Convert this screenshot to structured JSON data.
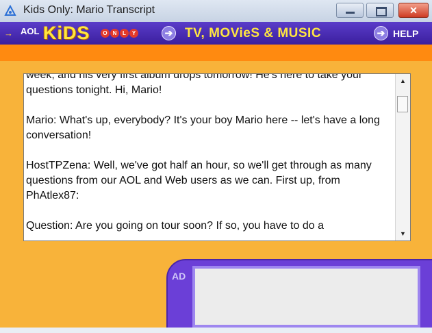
{
  "window": {
    "title": "Kids Only:  Mario Transcript",
    "controls": [
      "minimize",
      "maximize",
      "close"
    ]
  },
  "navbar": {
    "brand_aol": "AOL",
    "brand_kids": "KiDS",
    "brand_only": [
      "O",
      "N",
      "L",
      "Y"
    ],
    "channel_label": "TV, MOVieS & MUSIC",
    "help_label": "HELP",
    "colors": {
      "bar": "#4a2db3",
      "text_accent": "#ffe640",
      "orange_band": "#ff8a10",
      "background": "#f8b33a"
    }
  },
  "transcript": {
    "paragraphs": [
      "week, and his very first album drops tomorrow! He's here to take your questions tonight. Hi, Mario!",
      "Mario:  What's up, everybody? It's your boy Mario here -- let's have a long conversation!",
      "HostTPZena:  Well, we've got half an hour, so we'll get through as many questions from our AOL and Web users as we can. First up, from PhAtlex87:",
      "Question:  Are you going on tour soon? If so, you have to do a"
    ]
  },
  "ad": {
    "label": "AD"
  }
}
